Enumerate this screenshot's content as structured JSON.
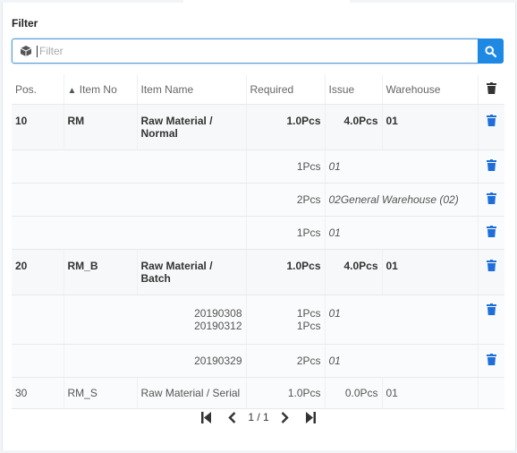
{
  "filter": {
    "label": "Filter",
    "placeholder": "Filter",
    "value": ""
  },
  "table": {
    "headers": {
      "pos": "Pos.",
      "item_no": "Item No",
      "item_name": "Item Name",
      "required": "Required",
      "issue": "Issue",
      "warehouse": "Warehouse"
    },
    "rows": [
      {
        "pos": "10",
        "item_no": "RM",
        "item_name": "Raw Material / Normal",
        "required": "1.0Pcs",
        "issue": "4.0Pcs",
        "warehouse": "01"
      },
      {
        "sub1_qty": "1Pcs",
        "sub1_wh": "01"
      },
      {
        "sub2_qty": "2Pcs",
        "sub2_wh": "02General Warehouse (02)"
      },
      {
        "sub3_qty": "1Pcs",
        "sub3_wh": "01"
      },
      {
        "pos": "20",
        "item_no": "RM_B",
        "item_name": "Raw Material / Batch",
        "required": "1.0Pcs",
        "issue": "4.0Pcs",
        "warehouse": "01"
      },
      {
        "batch1": "20190308",
        "batch1_qty": "1Pcs",
        "batch1_wh": "01",
        "batch2": "20190312",
        "batch2_qty": "1Pcs"
      },
      {
        "batch3": "20190329",
        "batch3_qty": "2Pcs",
        "batch3_wh": "01"
      },
      {
        "pos": "30",
        "item_no": "RM_S",
        "item_name": "Raw Material / Serial",
        "required": "1.0Pcs",
        "issue": "0.0Pcs",
        "warehouse": "01"
      }
    ]
  },
  "pager": {
    "info": "1 / 1"
  },
  "colors": {
    "accent": "#1e88e5",
    "trash": "#1e6fd9"
  }
}
